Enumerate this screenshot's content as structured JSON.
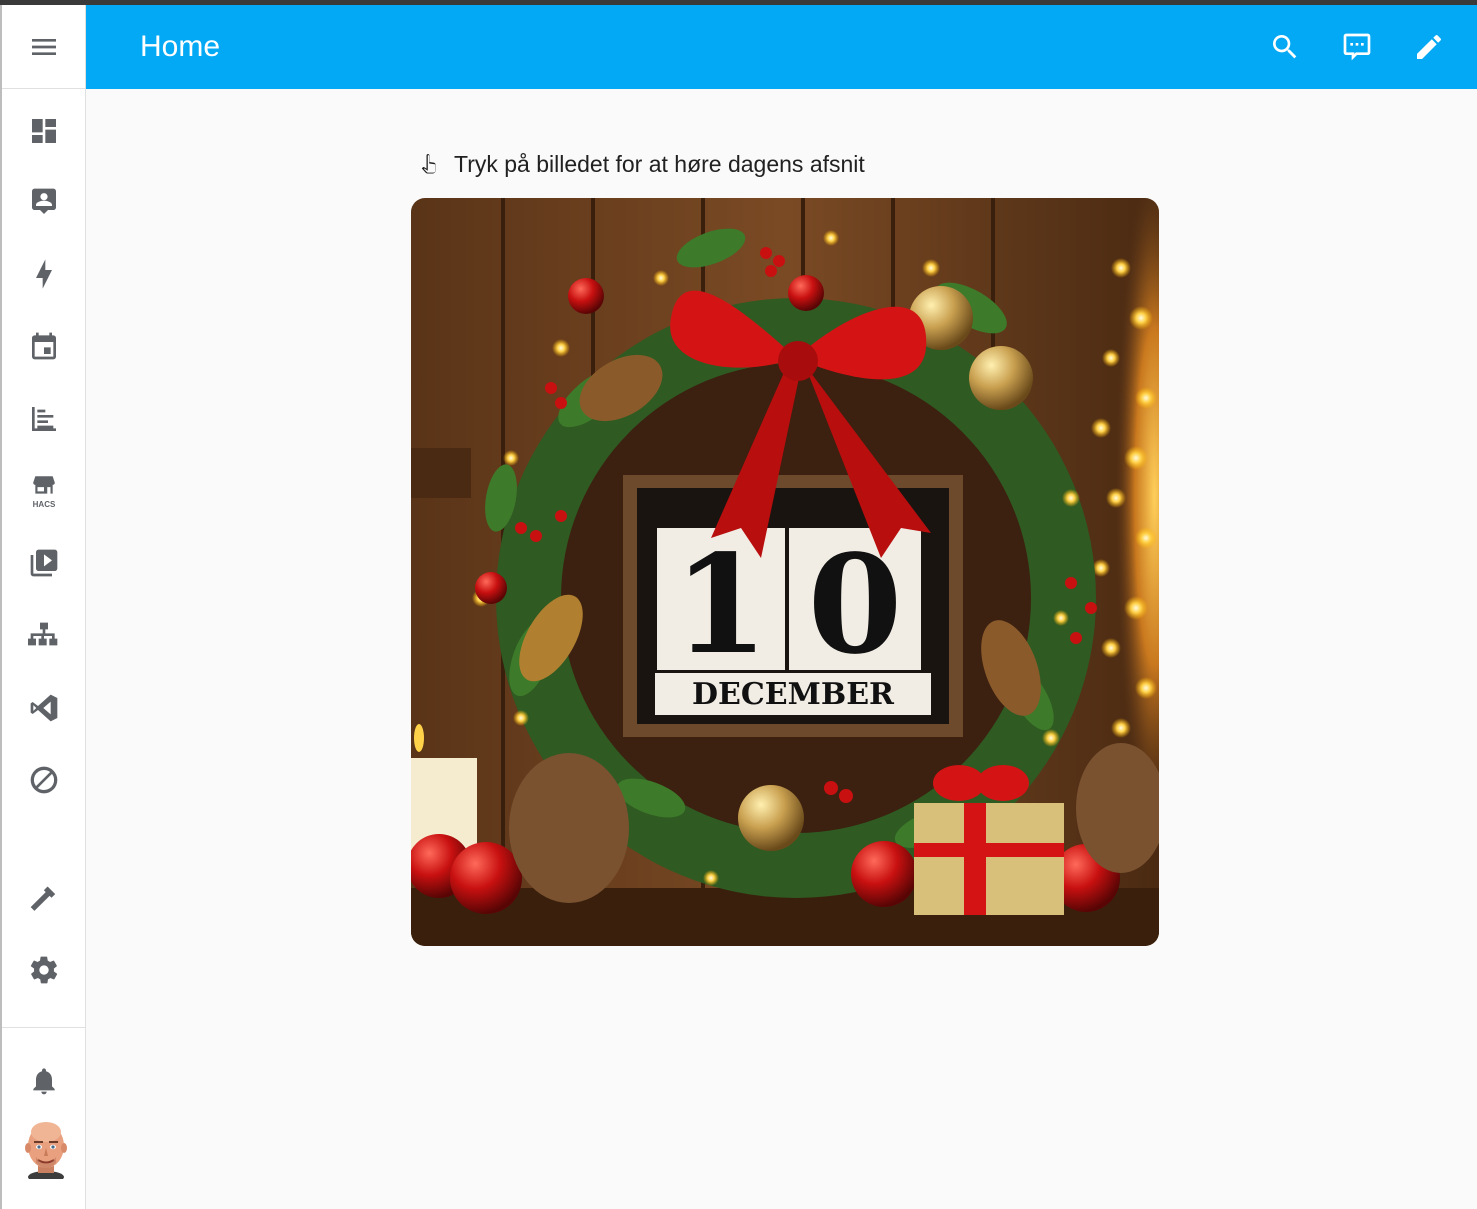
{
  "header": {
    "title": "Home",
    "actions": [
      {
        "name": "search",
        "icon": "search-icon"
      },
      {
        "name": "assist",
        "icon": "chat-icon"
      },
      {
        "name": "edit",
        "icon": "pencil-icon"
      }
    ]
  },
  "sidebar": {
    "menu_icon": "menu-icon",
    "hacs_label": "HACS",
    "items": [
      {
        "name": "overview",
        "icon": "dashboard-icon"
      },
      {
        "name": "map",
        "icon": "account-box-icon"
      },
      {
        "name": "energy",
        "icon": "lightning-icon"
      },
      {
        "name": "calendar",
        "icon": "calendar-icon"
      },
      {
        "name": "logbook",
        "icon": "logbook-icon"
      },
      {
        "name": "hacs",
        "icon": "store-icon"
      },
      {
        "name": "media",
        "icon": "media-icon"
      },
      {
        "name": "network",
        "icon": "sitemap-icon"
      },
      {
        "name": "vscode",
        "icon": "vscode-icon"
      },
      {
        "name": "zwave",
        "icon": "zwave-icon"
      },
      {
        "name": "developer-tools",
        "icon": "hammer-icon"
      },
      {
        "name": "settings",
        "icon": "gear-icon"
      },
      {
        "name": "notifications",
        "icon": "bell-icon"
      }
    ]
  },
  "card": {
    "icon": "hand-pointer-icon",
    "title": "Tryk på billedet for at høre dagens afsnit",
    "image": {
      "day": "10",
      "month": "DECEMBER"
    }
  },
  "colors": {
    "header": "#03a9f4",
    "accent_red": "#d41414",
    "wreath_green": "#2f5a22"
  }
}
